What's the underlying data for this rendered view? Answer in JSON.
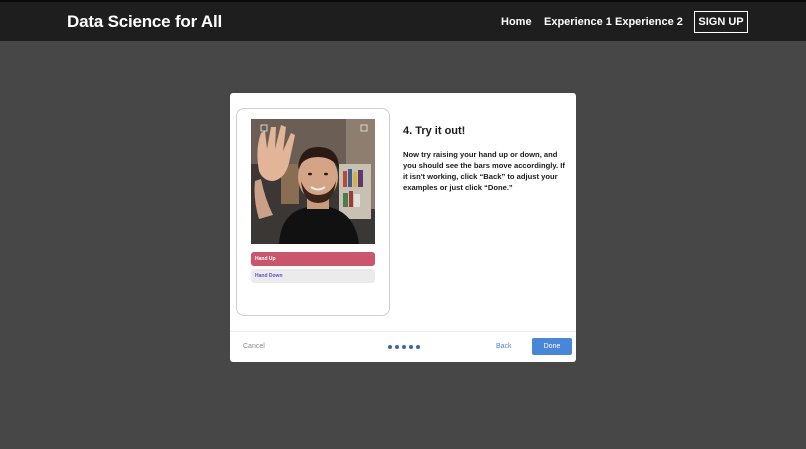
{
  "header": {
    "brand": "Data Science for All",
    "nav": [
      "Home",
      "Experience 1",
      "Experience 2"
    ],
    "signup": "SIGN UP"
  },
  "modal": {
    "bars": {
      "up_label": "Hand Up",
      "down_label": "Hand Down"
    },
    "step_title": "4. Try it out!",
    "step_body": "Now try raising your hand up or down, and you should see the bars move accordingly. If it isn't working, click “Back” to adjust your examples or just click “Done.”",
    "footer": {
      "cancel": "Cancel",
      "back": "Back",
      "done": "Done",
      "total_steps": 5,
      "current_step": 5
    }
  },
  "colors": {
    "accent": "#4a86d8",
    "hand_up_bar": "#c9566a",
    "hand_down_text": "#5a4fd6"
  }
}
